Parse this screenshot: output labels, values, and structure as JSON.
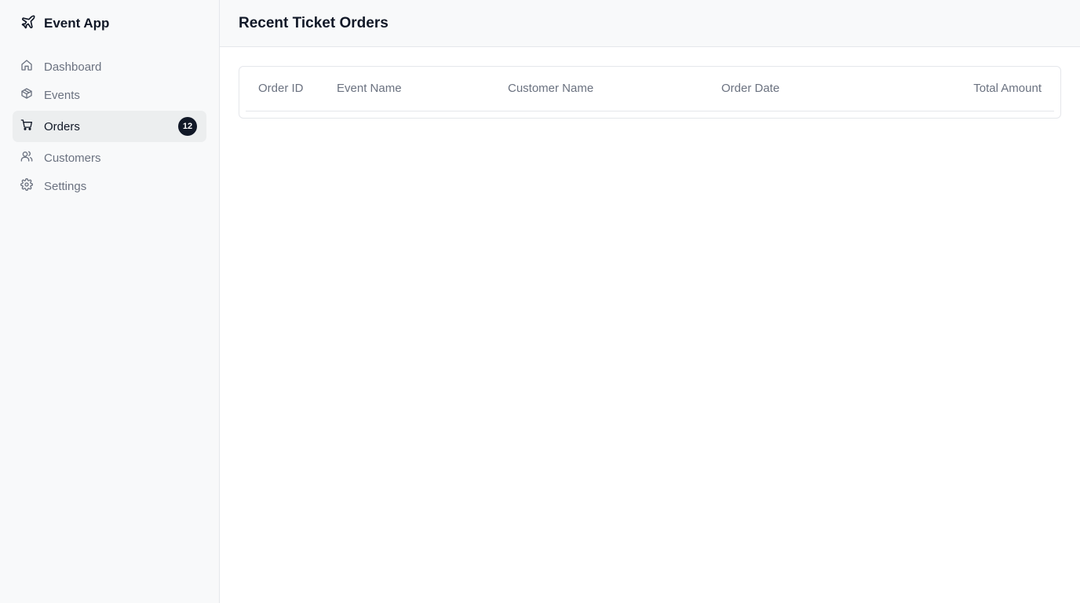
{
  "app": {
    "name": "Event App"
  },
  "sidebar": {
    "items": [
      {
        "label": "Dashboard",
        "icon": "home-icon"
      },
      {
        "label": "Events",
        "icon": "package-icon"
      },
      {
        "label": "Orders",
        "icon": "shopping-cart-icon",
        "badge": "12",
        "active": true
      },
      {
        "label": "Customers",
        "icon": "users-icon"
      },
      {
        "label": "Settings",
        "icon": "gear-icon"
      }
    ]
  },
  "header": {
    "title": "Recent Ticket Orders"
  },
  "table": {
    "columns": [
      "Order ID",
      "Event Name",
      "Customer Name",
      "Order Date",
      "Total Amount"
    ],
    "rows": []
  }
}
